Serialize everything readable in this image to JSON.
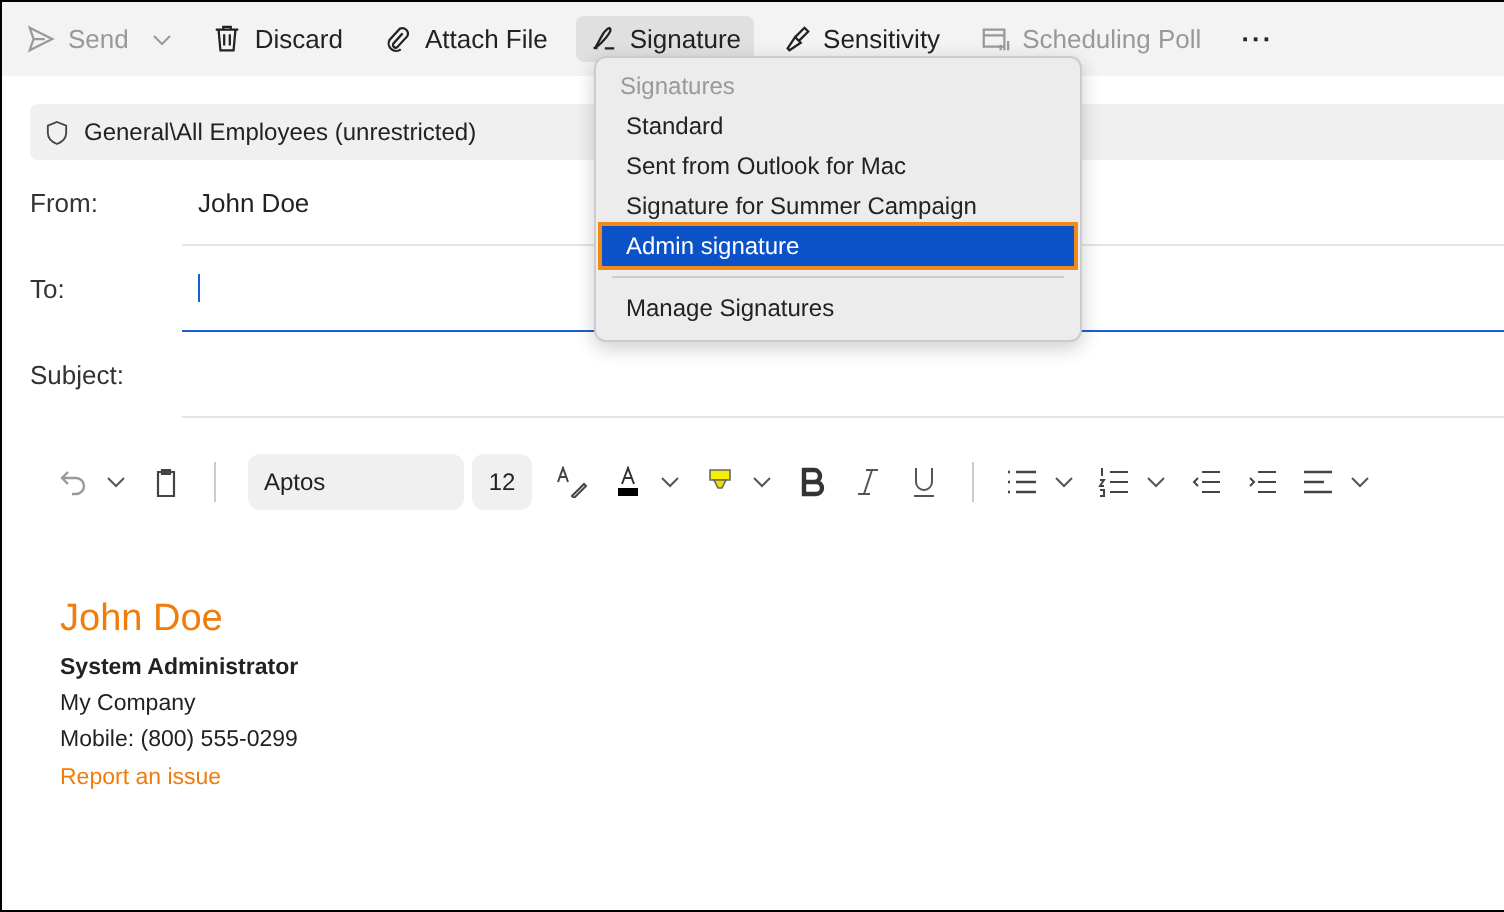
{
  "toolbar": [
    {
      "kind": "send",
      "label": "Send",
      "disabled": true,
      "dropdown": true,
      "selected": false
    },
    {
      "kind": "trash",
      "label": "Discard",
      "disabled": false,
      "dropdown": false,
      "selected": false
    },
    {
      "kind": "clip",
      "label": "Attach File",
      "disabled": false,
      "dropdown": false,
      "selected": false
    },
    {
      "kind": "pen",
      "label": "Signature",
      "disabled": false,
      "dropdown": false,
      "selected": true
    },
    {
      "kind": "tag",
      "label": "Sensitivity",
      "disabled": false,
      "dropdown": false,
      "selected": false
    },
    {
      "kind": "poll",
      "label": "Scheduling Poll",
      "disabled": true,
      "dropdown": false,
      "selected": false
    }
  ],
  "more": "···",
  "sensitivity_bar": {
    "label": "General\\All Employees (unrestricted)"
  },
  "fields": [
    {
      "label": "From:",
      "value": "John Doe",
      "focused": false
    },
    {
      "label": "To:",
      "focused": true
    },
    {
      "label": "Subject:",
      "focused": false
    }
  ],
  "format": {
    "font": "Aptos",
    "size": "12"
  },
  "signature_menu": {
    "header": "Signatures",
    "items": [
      {
        "label": "Standard",
        "selected": false
      },
      {
        "label": "Sent from Outlook for Mac",
        "selected": false
      },
      {
        "label": "Signature for Summer Campaign",
        "selected": false
      },
      {
        "label": "Admin signature",
        "selected": true
      }
    ],
    "manage": "Manage Signatures"
  },
  "signature": {
    "name": "John Doe",
    "title": "System Administrator",
    "company": "My Company",
    "phone": "Mobile: (800) 555-0299",
    "link": "Report an issue"
  }
}
